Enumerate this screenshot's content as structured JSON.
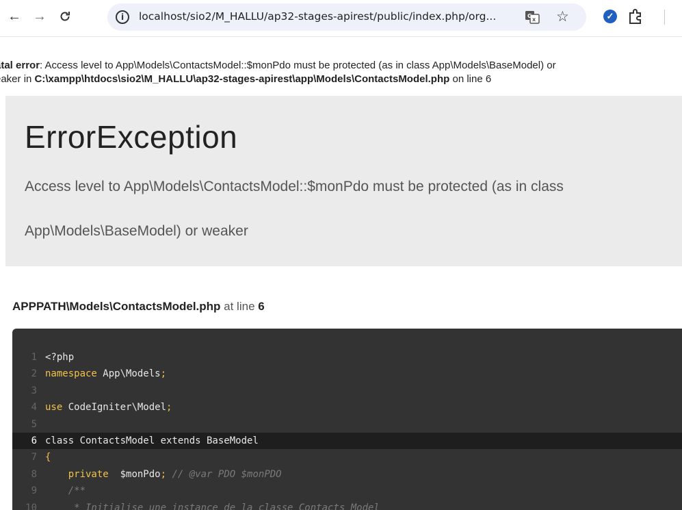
{
  "browser": {
    "url": "localhost/sio2/M_HALLU/ap32-stages-apirest/public/index.php/org...",
    "nav": {
      "back": "←",
      "forward": "→",
      "reload": "C"
    }
  },
  "fatal": {
    "prefix": "atal error",
    "message": ": Access level to App\\Models\\ContactsModel::$monPdo must be protected (as in class App\\Models\\BaseModel) or",
    "line2_prefix": "eaker in ",
    "path": "C:\\xampp\\htdocs\\sio2\\M_HALLU\\ap32-stages-apirest\\app\\Models\\ContactsModel.php",
    "line2_suffix": " on line 6"
  },
  "exception": {
    "title": "ErrorException",
    "message": "Access level to App\\Models\\ContactsModel::$monPdo must be protected (as in class App\\Models\\BaseModel) or weaker"
  },
  "source": {
    "file": "APPPATH\\Models\\ContactsModel.php",
    "at_line_label": " at line ",
    "line": "6"
  },
  "code": [
    {
      "n": "1",
      "t": "<?php"
    },
    {
      "n": "2",
      "kw": "namespace",
      "t": " App\\Models;"
    },
    {
      "n": "3",
      "t": ""
    },
    {
      "n": "4",
      "kw": "use",
      "t": " CodeIgniter\\Model;"
    },
    {
      "n": "5",
      "t": ""
    },
    {
      "n": "6",
      "t": "class ContactsModel extends BaseModel"
    },
    {
      "n": "7",
      "t": "{"
    },
    {
      "n": "8",
      "t": "    private  $monPdo; // @var PDO $monPDO"
    },
    {
      "n": "9",
      "t": "    /**"
    },
    {
      "n": "10",
      "t": "     * Initialise une instance de la classe Contacts Model"
    }
  ]
}
